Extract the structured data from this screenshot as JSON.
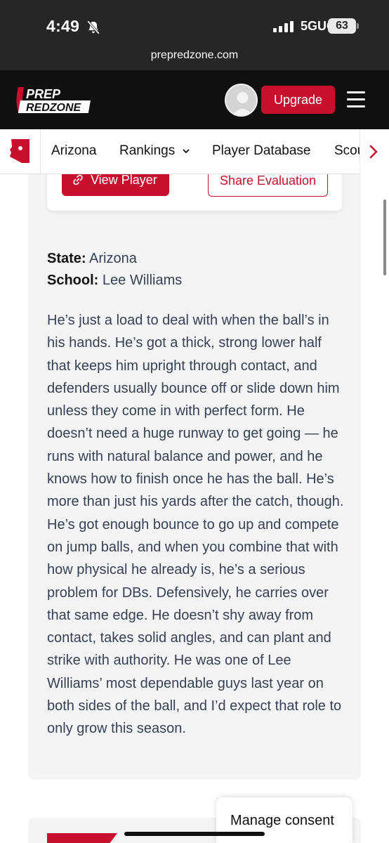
{
  "status_bar": {
    "time": "4:49",
    "network": "5GUC",
    "battery": "63",
    "url": "prepredzone.com"
  },
  "header": {
    "logo_top": "PREP",
    "logo_bottom": "REDZONE",
    "upgrade_label": "Upgrade"
  },
  "nav": {
    "items": [
      "Arizona",
      "Rankings",
      "Player Database",
      "Scou"
    ]
  },
  "actions": {
    "view_player": "View Player",
    "share_evaluation": "Share Evaluation"
  },
  "player": {
    "state_label": "State:",
    "state_value": "Arizona",
    "school_label": "School:",
    "school_value": "Lee Williams"
  },
  "evaluation": "He’s just a load to deal with when the ball’s in his hands. He’s got a thick, strong lower half that keeps him upright through contact, and defenders usually bounce off or slide down him unless they come in with perfect form. He doesn’t need a huge runway to get going — he runs with natural balance and power, and he knows how to finish once he has the ball. He’s more than just his yards after the catch, though. He’s got enough bounce to go up and compete on jump balls, and when you combine that with how physical he already is, he’s a serious problem for DBs. Defensively, he carries over that same edge. He doesn’t shy away from contact, takes solid angles, and can plant and strike with authority. He was one of Lee Williams’ most dependable guys last year on both sides of the ball, and I’d expect that role to only grow this season.",
  "consent": "Manage consent",
  "colors": {
    "brand_red": "#c8102e",
    "header_bg": "#101010",
    "card_bg": "#f3f4f6"
  }
}
